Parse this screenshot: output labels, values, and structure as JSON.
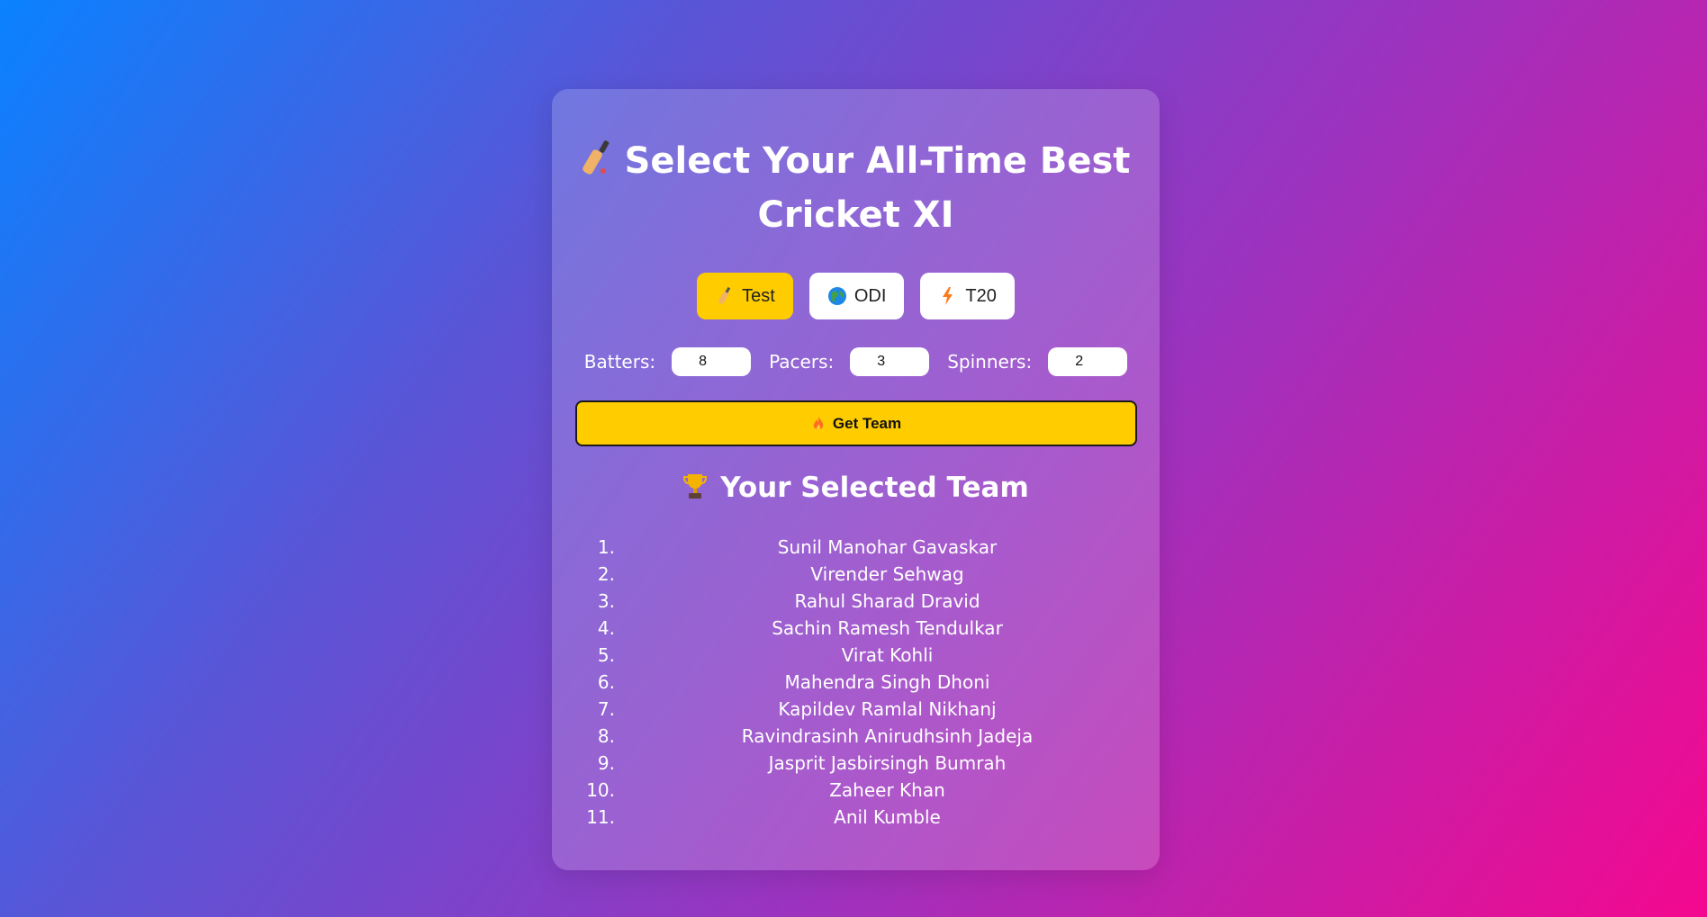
{
  "header": {
    "title": "Select Your All-Time Best Cricket XI",
    "icon": "cricket-bat-icon"
  },
  "formats": [
    {
      "label": "Test",
      "icon": "cricket-bat-icon",
      "active": true
    },
    {
      "label": "ODI",
      "icon": "globe-icon",
      "active": false
    },
    {
      "label": "T20",
      "icon": "lightning-icon",
      "active": false
    }
  ],
  "counts": {
    "batters_label": "Batters:",
    "batters_value": "8",
    "pacers_label": "Pacers:",
    "pacers_value": "3",
    "spinners_label": "Spinners:",
    "spinners_value": "2"
  },
  "get_team": {
    "label": "Get Team",
    "icon": "fire-icon"
  },
  "team": {
    "title": "Your Selected Team",
    "icon": "trophy-icon",
    "players": [
      {
        "num": "1.",
        "name": "Sunil Manohar Gavaskar"
      },
      {
        "num": "2.",
        "name": "Virender Sehwag"
      },
      {
        "num": "3.",
        "name": "Rahul Sharad Dravid"
      },
      {
        "num": "4.",
        "name": "Sachin Ramesh Tendulkar"
      },
      {
        "num": "5.",
        "name": "Virat Kohli"
      },
      {
        "num": "6.",
        "name": "Mahendra Singh Dhoni"
      },
      {
        "num": "7.",
        "name": "Kapildev Ramlal Nikhanj"
      },
      {
        "num": "8.",
        "name": "Ravindrasinh Anirudhsinh Jadeja"
      },
      {
        "num": "9.",
        "name": "Jasprit Jasbirsingh Bumrah"
      },
      {
        "num": "10.",
        "name": "Zaheer Khan"
      },
      {
        "num": "11.",
        "name": "Anil Kumble"
      }
    ]
  },
  "colors": {
    "accent": "#ffcc00",
    "card": "rgba(255,255,255,0.18)"
  }
}
